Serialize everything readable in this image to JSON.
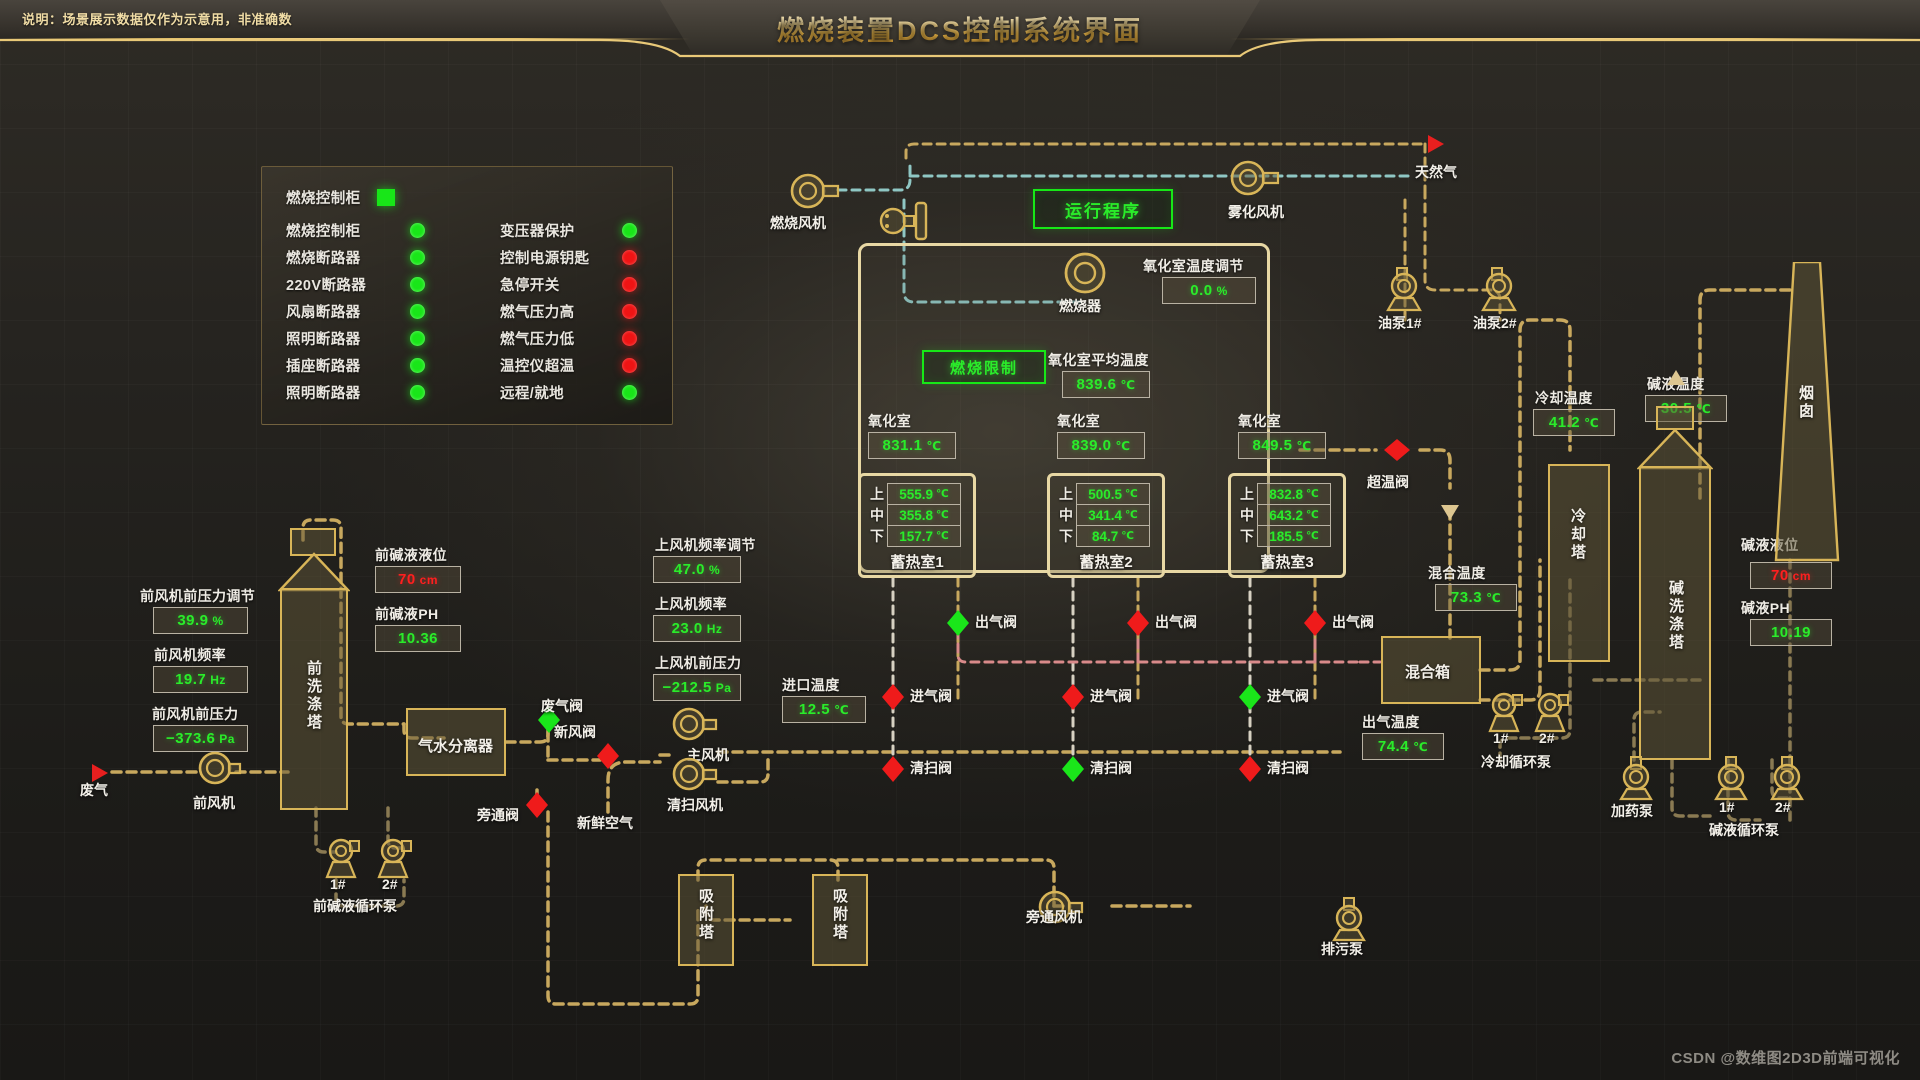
{
  "header": {
    "note": "说明：场景展示数据仅作为示意用，非准确数",
    "title": "燃烧装置DCS控制系统界面"
  },
  "status_panel": {
    "top_item": {
      "label": "燃烧控制柜",
      "indicator": "square",
      "color": "#18e618"
    },
    "left_column": [
      {
        "label": "燃烧控制柜",
        "state": "green"
      },
      {
        "label": "燃烧断路器",
        "state": "green"
      },
      {
        "label": "220V断路器",
        "state": "green"
      },
      {
        "label": "风扇断路器",
        "state": "green"
      },
      {
        "label": "照明断路器",
        "state": "green"
      },
      {
        "label": "插座断路器",
        "state": "green"
      },
      {
        "label": "照明断路器",
        "state": "green"
      }
    ],
    "right_column": [
      {
        "label": "变压器保护",
        "state": "green"
      },
      {
        "label": "控制电源钥匙",
        "state": "red"
      },
      {
        "label": "急停开关",
        "state": "red"
      },
      {
        "label": "燃气压力高",
        "state": "red"
      },
      {
        "label": "燃气压力低",
        "state": "red"
      },
      {
        "label": "温控仪超温",
        "state": "red"
      },
      {
        "label": "远程/就地",
        "state": "green"
      }
    ]
  },
  "buttons": {
    "run_program": "运行程序",
    "burn_limit": "燃烧限制"
  },
  "reactor": {
    "oxidation_adjust_label": "氧化室温度调节",
    "oxidation_adjust_value": "0.0",
    "oxidation_adjust_unit": "%",
    "oxidation_avg_label": "氧化室平均温度",
    "oxidation_avg_value": "839.6",
    "oxidation_avg_unit": "℃",
    "oxidation_cells": [
      {
        "label": "氧化室",
        "value": "831.1",
        "unit": "℃"
      },
      {
        "label": "氧化室",
        "value": "839.0",
        "unit": "℃"
      },
      {
        "label": "氧化室",
        "value": "849.5",
        "unit": "℃"
      }
    ],
    "chambers": [
      {
        "name": "蓄热室1",
        "rows": [
          {
            "key": "上",
            "value": "555.9",
            "unit": "℃"
          },
          {
            "key": "中",
            "value": "355.8",
            "unit": "℃"
          },
          {
            "key": "下",
            "value": "157.7",
            "unit": "℃"
          }
        ]
      },
      {
        "name": "蓄热室2",
        "rows": [
          {
            "key": "上",
            "value": "500.5",
            "unit": "℃"
          },
          {
            "key": "中",
            "value": "341.4",
            "unit": "℃"
          },
          {
            "key": "下",
            "value": "84.7",
            "unit": "℃"
          }
        ]
      },
      {
        "name": "蓄热室3",
        "rows": [
          {
            "key": "上",
            "value": "832.8",
            "unit": "℃"
          },
          {
            "key": "中",
            "value": "643.2",
            "unit": "℃"
          },
          {
            "key": "下",
            "value": "185.5",
            "unit": "℃"
          }
        ]
      }
    ]
  },
  "left_section": {
    "pre_fan_pressure_adjust_label": "前风机前压力调节",
    "pre_fan_pressure_adjust_value": "39.9",
    "pre_fan_pressure_adjust_unit": "%",
    "pre_fan_freq_label": "前风机频率",
    "pre_fan_freq_value": "19.7",
    "pre_fan_freq_unit": "Hz",
    "pre_fan_pressure_label": "前风机前压力",
    "pre_fan_pressure_value": "−373.6",
    "pre_fan_pressure_unit": "Pa",
    "waste_gas_label": "废气",
    "pre_fan_name": "前风机",
    "pre_wash_tower": "前洗涤塔",
    "pre_alkali_level_label": "前碱液液位",
    "pre_alkali_level_value": "70",
    "pre_alkali_level_unit": "cm",
    "pre_alkali_ph_label": "前碱液PH",
    "pre_alkali_ph_value": "10.36",
    "pre_alkali_pump_name": "前碱液循环泵",
    "pump_1": "1#",
    "pump_2": "2#",
    "gas_water_separator": "气水分离器"
  },
  "mid_section": {
    "up_fan_freq_adjust_label": "上风机频率调节",
    "up_fan_freq_adjust_value": "47.0",
    "up_fan_freq_adjust_unit": "%",
    "up_fan_freq_label": "上风机频率",
    "up_fan_freq_value": "23.0",
    "up_fan_freq_unit": "Hz",
    "up_fan_pressure_label": "上风机前压力",
    "up_fan_pressure_value": "−212.5",
    "up_fan_pressure_unit": "Pa",
    "inlet_temp_label": "进口温度",
    "inlet_temp_value": "12.5",
    "inlet_temp_unit": "℃",
    "waste_valve": "废气阀",
    "fresh_valve": "新风阀",
    "bypass_valve": "旁通阀",
    "fresh_air": "新鲜空气",
    "main_fan": "主风机",
    "purge_fan": "清扫风机",
    "burn_fan": "燃烧风机",
    "burner": "燃烧器",
    "atomizing_fan": "雾化风机",
    "natural_gas": "天然气",
    "oil_pump_1": "油泵1#",
    "oil_pump_2": "油泵2#"
  },
  "valves": {
    "out_gas": "出气阀",
    "in_gas": "进气阀",
    "purge": "清扫阀",
    "overtemp": "超温阀",
    "rows": [
      {
        "out_gas": "green",
        "in_gas": "red",
        "purge": "red"
      },
      {
        "out_gas": "red",
        "in_gas": "red",
        "purge": "green"
      },
      {
        "out_gas": "red",
        "in_gas": "green",
        "purge": "red"
      }
    ],
    "overtemp_state": "red"
  },
  "right_section": {
    "mix_temp_label": "混合温度",
    "mix_temp_value": "73.3",
    "mix_temp_unit": "℃",
    "mix_box": "混合箱",
    "out_gas_temp_label": "出气温度",
    "out_gas_temp_value": "74.4",
    "out_gas_temp_unit": "℃",
    "cooling_temp_label": "冷却温度",
    "cooling_temp_value": "41.2",
    "cooling_temp_unit": "℃",
    "cooling_tower": "冷却塔",
    "cooling_pump_name": "冷却循环泵",
    "alkali_temp_label": "碱液温度",
    "alkali_temp_value": "30.5",
    "alkali_temp_unit": "℃",
    "alkali_wash_tower": "碱洗涤塔",
    "alkali_level_label": "碱液液位",
    "alkali_level_value": "70",
    "alkali_level_unit": "cm",
    "alkali_ph_label": "碱液PH",
    "alkali_ph_value": "10.19",
    "alkali_pump_name": "碱液循环泵",
    "dosing_pump": "加药泵",
    "chimney": "烟囱",
    "pump_1": "1#",
    "pump_2": "2#"
  },
  "bottom_section": {
    "adsorption_tower_1": "吸附塔",
    "adsorption_tower_2": "吸附塔",
    "bypass_fan": "旁通风机",
    "blowdown_pump": "排污泵"
  },
  "watermark": "CSDN @数维图2D3D前端可视化"
}
